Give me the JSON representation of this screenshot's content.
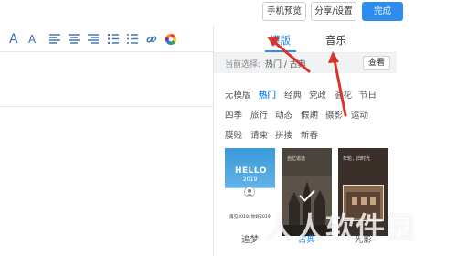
{
  "header": {
    "preview_label": "手机预览",
    "share_label": "分享/设置",
    "done_label": "完成"
  },
  "editor_toolbar": {
    "font_large_label": "A",
    "font_small_label": "A",
    "icons": [
      "font-size-increase-icon",
      "font-size-decrease-icon",
      "align-left-icon",
      "align-center-icon",
      "align-right-icon",
      "ordered-list-icon",
      "unordered-list-icon",
      "link-icon",
      "color-wheel-icon"
    ],
    "accent": "#3a6fb0"
  },
  "panel": {
    "tabs": [
      {
        "label": "模版",
        "active": true
      },
      {
        "label": "音乐",
        "active": false
      }
    ],
    "current_selection_label": "当前选择:",
    "current_selection_path": "热门 / 古典",
    "view_button_label": "查看",
    "categories_row1": [
      "无模版",
      "热门",
      "经典",
      "党政",
      "荟花",
      "节日"
    ],
    "categories_row2": [
      "四季",
      "旅行",
      "动态",
      "假期",
      "摄影",
      "运动"
    ],
    "categories_row3": [
      "膜贱",
      "请柬",
      "拼接",
      "新春"
    ],
    "active_category": "热门",
    "cards": [
      {
        "caption": "追梦",
        "title": "HELLO",
        "year": "2019",
        "text_line1": "再见2018, 你好2019",
        "selected": false
      },
      {
        "caption": "古典",
        "text": "自忆追逸",
        "selected": true
      },
      {
        "caption": "光影",
        "text": "年轮，旧时光",
        "selected": false
      }
    ],
    "accent": "#2d8cf0"
  },
  "watermark": "人人软件园"
}
